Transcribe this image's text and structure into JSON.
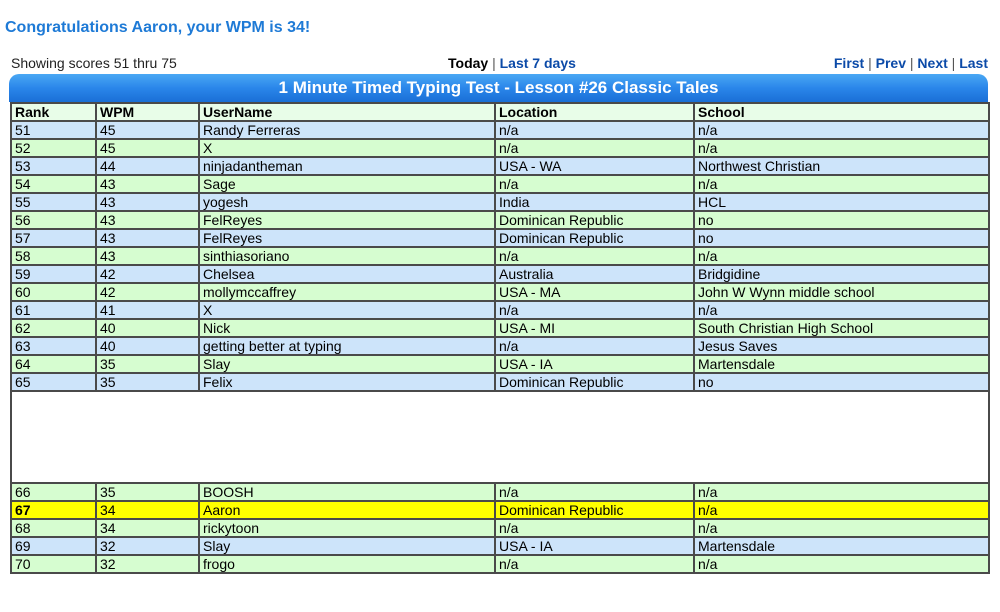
{
  "congrats": "Congratulations Aaron, your WPM is 34!",
  "nav": {
    "showing": "Showing scores 51 thru 75",
    "today": "Today",
    "last7": "Last 7 days",
    "first": "First",
    "prev": "Prev",
    "next": "Next",
    "last": "Last",
    "sep": "|"
  },
  "table": {
    "title": "1 Minute Timed Typing Test - Lesson #26 Classic Tales",
    "headers": [
      "Rank",
      "WPM",
      "UserName",
      "Location",
      "School"
    ],
    "rows": [
      [
        "51",
        "45",
        "Randy Ferreras",
        "n/a",
        "n/a"
      ],
      [
        "52",
        "45",
        "X",
        "n/a",
        "n/a"
      ],
      [
        "53",
        "44",
        "ninjadantheman",
        "USA - WA",
        "Northwest Christian"
      ],
      [
        "54",
        "43",
        "Sage",
        "n/a",
        "n/a"
      ],
      [
        "55",
        "43",
        "yogesh",
        "India",
        "HCL"
      ],
      [
        "56",
        "43",
        "FelReyes",
        "Dominican Republic",
        "no"
      ],
      [
        "57",
        "43",
        "FelReyes",
        "Dominican Republic",
        "no"
      ],
      [
        "58",
        "43",
        "sinthiasoriano",
        "n/a",
        "n/a"
      ],
      [
        "59",
        "42",
        "Chelsea",
        "Australia",
        "Bridgidine"
      ],
      [
        "60",
        "42",
        "mollymccaffrey",
        "USA - MA",
        "John W Wynn middle school"
      ],
      [
        "61",
        "41",
        "X",
        "n/a",
        "n/a"
      ],
      [
        "62",
        "40",
        "Nick",
        "USA - MI",
        "South Christian High School"
      ],
      [
        "63",
        "40",
        "getting better at typing",
        "n/a",
        "Jesus Saves"
      ],
      [
        "64",
        "35",
        "Slay",
        "USA - IA",
        "Martensdale"
      ],
      [
        "65",
        "35",
        "Felix",
        "Dominican Republic",
        "no"
      ]
    ],
    "rows_after": [
      [
        "66",
        "35",
        "BOOSH",
        "n/a",
        "n/a"
      ],
      [
        "67",
        "34",
        "Aaron",
        "Dominican Republic",
        "n/a"
      ],
      [
        "68",
        "34",
        "rickytoon",
        "n/a",
        "n/a"
      ],
      [
        "69",
        "32",
        "Slay",
        "USA - IA",
        "Martensdale"
      ],
      [
        "70",
        "32",
        "frogo",
        "n/a",
        "n/a"
      ]
    ],
    "highlight_user": "Aaron"
  },
  "colors": {
    "row_blue": "#cde4fa",
    "row_green": "#d6fdd0",
    "row_highlight": "#ffff00",
    "title_bar": "#2a86ea",
    "congrats_text": "#1e7ad6",
    "link": "#0b4aa8"
  }
}
